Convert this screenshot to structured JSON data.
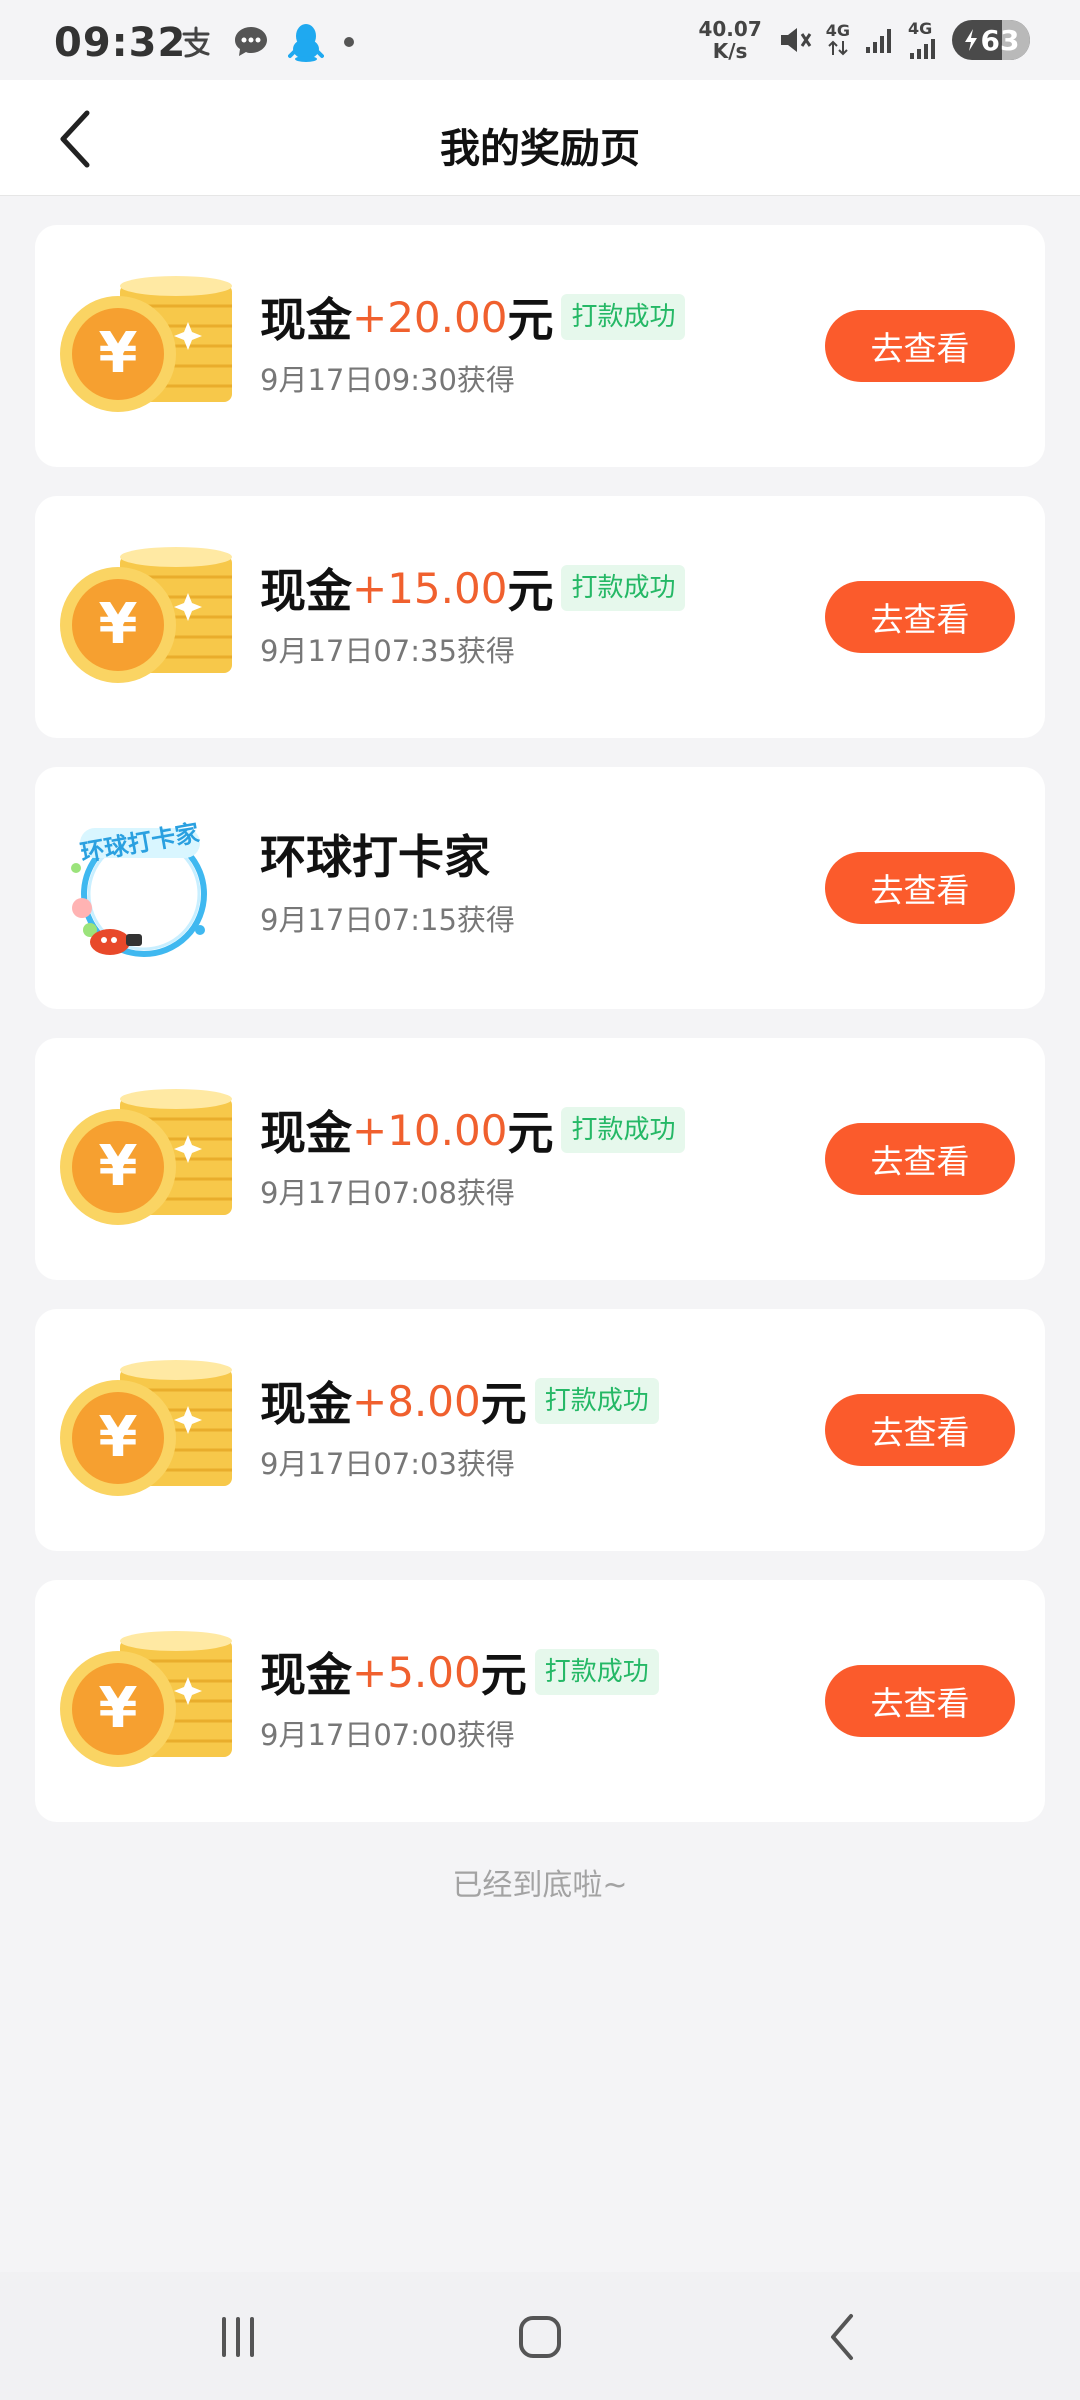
{
  "status_bar": {
    "time": "09:32",
    "net_speed_value": "40.07",
    "net_speed_unit": "K/s",
    "signal_label_1": "4G",
    "signal_label_2": "4G",
    "battery": "63",
    "icons": [
      "alipay-icon",
      "message-icon",
      "qq-icon",
      "dot-icon",
      "mute-icon",
      "data-arrows-icon",
      "signal-icon",
      "charging-icon"
    ]
  },
  "header": {
    "title": "我的奖励页"
  },
  "rewards": [
    {
      "prefix": "现金",
      "amount": "+20.00",
      "unit": "元",
      "badge": "打款成功",
      "time": "9月17日09:30获得",
      "button": "去查看"
    },
    {
      "prefix": "现金",
      "amount": "+15.00",
      "unit": "元",
      "badge": "打款成功",
      "time": "9月17日07:35获得",
      "button": "去查看"
    },
    {
      "title": "环球打卡家",
      "time": "9月17日07:15获得",
      "button": "去查看"
    },
    {
      "prefix": "现金",
      "amount": "+10.00",
      "unit": "元",
      "badge": "打款成功",
      "time": "9月17日07:08获得",
      "button": "去查看"
    },
    {
      "prefix": "现金",
      "amount": "+8.00",
      "unit": "元",
      "badge": "打款成功",
      "time": "9月17日07:03获得",
      "button": "去查看"
    },
    {
      "prefix": "现金",
      "amount": "+5.00",
      "unit": "元",
      "badge": "打款成功",
      "time": "9月17日07:00获得",
      "button": "去查看"
    }
  ],
  "footer_text": "已经到底啦~",
  "frame_text": "环球打卡家",
  "colors": {
    "accent": "#fb5b2c",
    "amount": "#f0602e",
    "success": "#25b866"
  }
}
